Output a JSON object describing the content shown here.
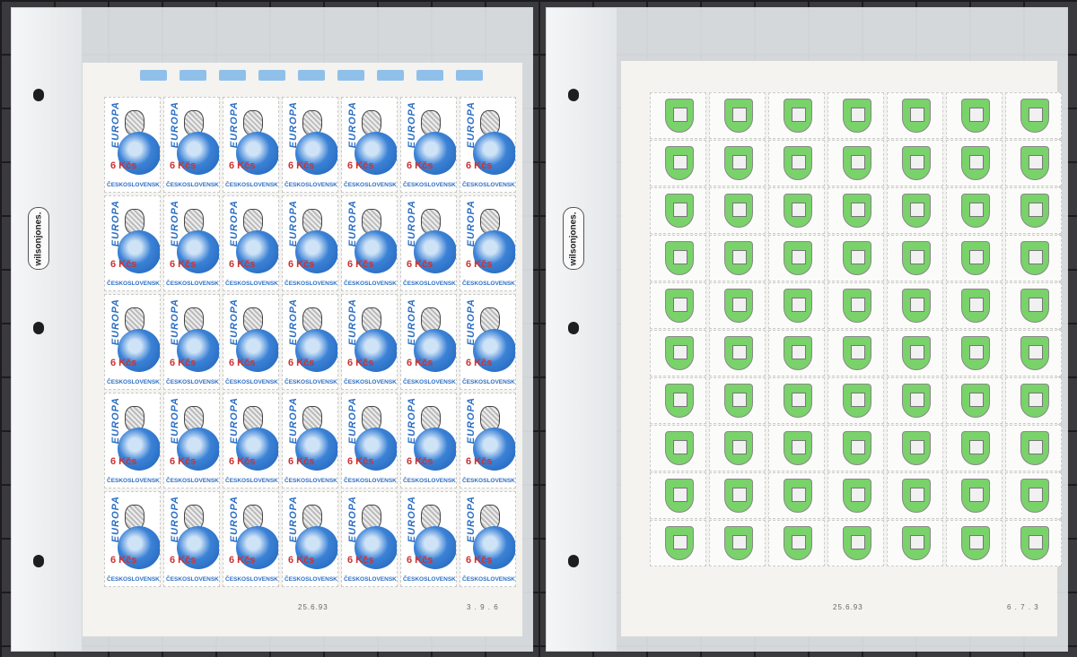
{
  "left_sheet": {
    "stamp_word": "EUROPA",
    "stamp_value": "6 Kčs",
    "stamp_country": "ČESKOSLOVENSKO",
    "rows": 5,
    "cols": 7,
    "footer_code": "25.6.93",
    "footer_plate": "3 . 9 . 6"
  },
  "right_sheet": {
    "rows": 10,
    "cols": 7,
    "footer_code": "25.6.93",
    "footer_plate": "6 . 7 . 3"
  },
  "binder_brand": "wilsonjones.",
  "colors": {
    "blue": "#2d6fc4",
    "green": "#79d26a",
    "red": "#c33333"
  }
}
